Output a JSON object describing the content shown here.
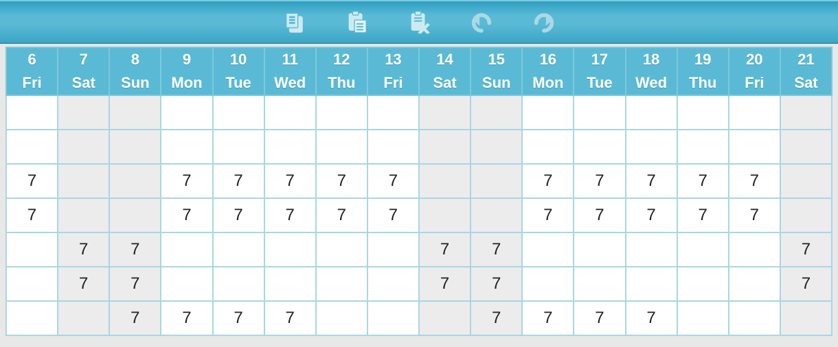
{
  "toolbar": {
    "buttons": [
      {
        "name": "copy-button",
        "icon": "copy-icon"
      },
      {
        "name": "paste-button",
        "icon": "paste-icon"
      },
      {
        "name": "delete-paste-button",
        "icon": "paste-delete-icon"
      },
      {
        "name": "undo-button",
        "icon": "undo-icon"
      },
      {
        "name": "redo-button",
        "icon": "redo-icon"
      }
    ]
  },
  "calendar": {
    "columns": [
      {
        "day": "6",
        "dow": "Fri",
        "weekend": false
      },
      {
        "day": "7",
        "dow": "Sat",
        "weekend": true
      },
      {
        "day": "8",
        "dow": "Sun",
        "weekend": true
      },
      {
        "day": "9",
        "dow": "Mon",
        "weekend": false
      },
      {
        "day": "10",
        "dow": "Tue",
        "weekend": false
      },
      {
        "day": "11",
        "dow": "Wed",
        "weekend": false
      },
      {
        "day": "12",
        "dow": "Thu",
        "weekend": false
      },
      {
        "day": "13",
        "dow": "Fri",
        "weekend": false
      },
      {
        "day": "14",
        "dow": "Sat",
        "weekend": true
      },
      {
        "day": "15",
        "dow": "Sun",
        "weekend": true
      },
      {
        "day": "16",
        "dow": "Mon",
        "weekend": false
      },
      {
        "day": "17",
        "dow": "Tue",
        "weekend": false
      },
      {
        "day": "18",
        "dow": "Wed",
        "weekend": false
      },
      {
        "day": "19",
        "dow": "Thu",
        "weekend": false
      },
      {
        "day": "20",
        "dow": "Fri",
        "weekend": false
      },
      {
        "day": "21",
        "dow": "Sat",
        "weekend": true
      }
    ],
    "rows": [
      [
        "",
        "",
        "",
        "",
        "",
        "",
        "",
        "",
        "",
        "",
        "",
        "",
        "",
        "",
        "",
        ""
      ],
      [
        "",
        "",
        "",
        "",
        "",
        "",
        "",
        "",
        "",
        "",
        "",
        "",
        "",
        "",
        "",
        ""
      ],
      [
        "7",
        "",
        "",
        "7",
        "7",
        "7",
        "7",
        "7",
        "",
        "",
        "7",
        "7",
        "7",
        "7",
        "7",
        ""
      ],
      [
        "7",
        "",
        "",
        "7",
        "7",
        "7",
        "7",
        "7",
        "",
        "",
        "7",
        "7",
        "7",
        "7",
        "7",
        ""
      ],
      [
        "",
        "7",
        "7",
        "",
        "",
        "",
        "",
        "",
        "7",
        "7",
        "",
        "",
        "",
        "",
        "",
        "7"
      ],
      [
        "",
        "7",
        "7",
        "",
        "",
        "",
        "",
        "",
        "7",
        "7",
        "",
        "",
        "",
        "",
        "",
        "7"
      ],
      [
        "",
        "",
        "7",
        "7",
        "7",
        "7",
        "",
        "",
        "",
        "7",
        "7",
        "7",
        "7",
        "",
        "",
        ""
      ]
    ]
  }
}
